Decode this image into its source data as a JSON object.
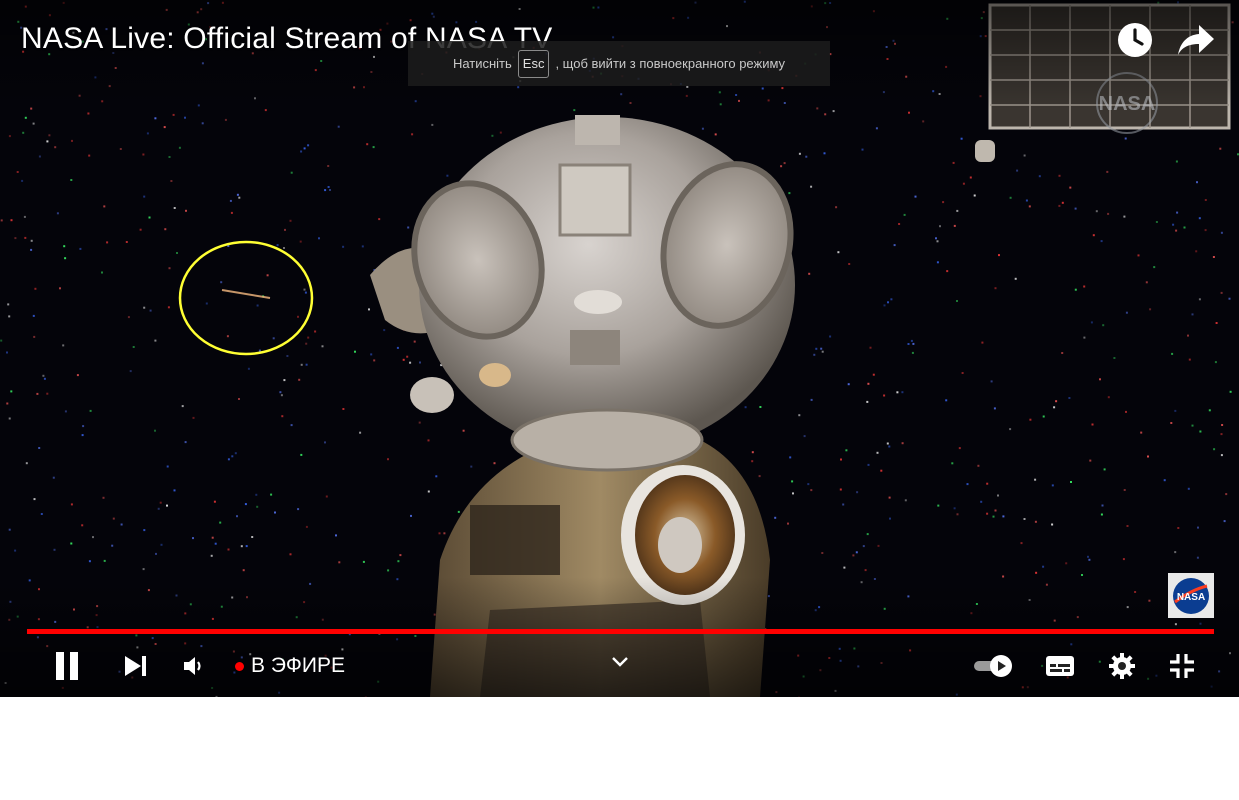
{
  "window": {
    "title": "NASA Live: Official Stream of NASA TV"
  },
  "top_actions": [
    {
      "name": "watch-later-icon",
      "label": ""
    },
    {
      "name": "share-icon",
      "label": ""
    }
  ],
  "fullscreen_toast": {
    "before": "Натисніть",
    "key": "Esc",
    "after": ", щоб вийти з повноекранного режиму"
  },
  "watermark": {
    "logo_text": "NASA",
    "colors": {
      "blue": "#0b3d91",
      "red": "#fc3d21"
    }
  },
  "progress": {
    "fraction": 1.0,
    "color": "#ff0000"
  },
  "controls": {
    "live_label": "В ЭФИРЕ",
    "live_dot_color": "#ff0000",
    "buttons": [
      "pause-icon",
      "next-icon",
      "volume-icon",
      "chevron-down-icon",
      "autoplay-toggle",
      "subtitles-icon",
      "gear-icon",
      "exit-fullscreen-icon"
    ]
  },
  "colors": {
    "space": "#04040a",
    "annotation_circle": "#ffff33",
    "progress": "#ff0000",
    "controls": "#ffffff"
  }
}
